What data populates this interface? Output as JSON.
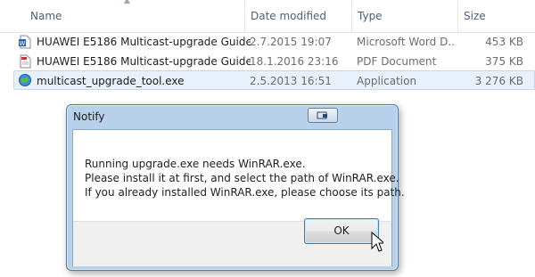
{
  "columns": {
    "name": "Name",
    "date": "Date modified",
    "type": "Type",
    "size": "Size"
  },
  "files": [
    {
      "name": "HUAWEI E5186 Multicast-upgrade Guide ...",
      "date": "2.7.2015 19:07",
      "type": "Microsoft Word D...",
      "size": "453 KB",
      "icon": "word-doc-icon"
    },
    {
      "name": "HUAWEI E5186 Multicast-upgrade Guide ...",
      "date": "18.1.2016 23:16",
      "type": "PDF Document",
      "size": "375 KB",
      "icon": "pdf-icon"
    },
    {
      "name": "multicast_upgrade_tool.exe",
      "date": "2.5.2013 16:51",
      "type": "Application",
      "size": "3 276 KB",
      "icon": "application-globe-icon"
    }
  ],
  "dialog": {
    "title": "Notify",
    "message_lines": [
      "Running upgrade.exe needs WinRAR.exe.",
      "Please install it at first, and select the path of WinRAR.exe.",
      "If you already installed WinRAR.exe, please choose its path."
    ],
    "ok_label": "OK"
  },
  "colors": {
    "header_text": "#4c607a",
    "selection": "#e8f0fb",
    "dialog_frame": "#b8d1ea",
    "ok_border": "#3c7fb1"
  }
}
